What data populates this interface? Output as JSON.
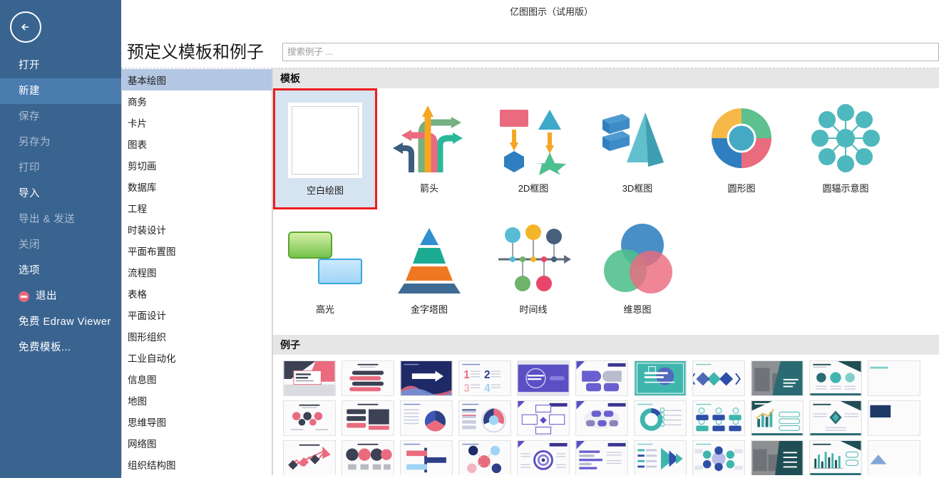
{
  "window": {
    "app_title": "亿图图示（试用版）"
  },
  "sidebar": {
    "back_icon": "back-arrow-icon",
    "items": [
      {
        "label": "打开",
        "state": "normal",
        "icon": null
      },
      {
        "label": "新建",
        "state": "active",
        "icon": null
      },
      {
        "label": "保存",
        "state": "dim",
        "icon": null
      },
      {
        "label": "另存为",
        "state": "dim",
        "icon": null
      },
      {
        "label": "打印",
        "state": "dim",
        "icon": null
      },
      {
        "label": "导入",
        "state": "normal",
        "icon": null
      },
      {
        "label": "导出 & 发送",
        "state": "dim",
        "icon": null
      },
      {
        "label": "关闭",
        "state": "dim",
        "icon": null
      },
      {
        "label": "选项",
        "state": "normal",
        "icon": null
      },
      {
        "label": "退出",
        "state": "normal",
        "icon": "exit-icon"
      },
      {
        "label": "免费 Edraw Viewer",
        "state": "normal",
        "icon": null
      },
      {
        "label": "免费模板...",
        "state": "normal",
        "icon": null
      }
    ]
  },
  "header": {
    "page_title": "预定义模板和例子",
    "search_placeholder": "搜索例子 ...",
    "search_value": ""
  },
  "categories": {
    "selected": "基本绘图",
    "items": [
      "基本绘图",
      "商务",
      "卡片",
      "图表",
      "剪切画",
      "数据库",
      "工程",
      "时装设计",
      "平面布置图",
      "流程图",
      "表格",
      "平面设计",
      "图形组织",
      "工业自动化",
      "信息图",
      "地图",
      "思维导图",
      "网络图",
      "组织结构图"
    ]
  },
  "templates_section": {
    "heading": "模板",
    "selected": "空白绘图",
    "items": [
      {
        "label": "空白绘图",
        "art": "blank-page",
        "selected": true
      },
      {
        "label": "箭头",
        "art": "arrows",
        "selected": false
      },
      {
        "label": "2D框图",
        "art": "block-2d",
        "selected": false
      },
      {
        "label": "3D框图",
        "art": "block-3d",
        "selected": false
      },
      {
        "label": "圆形图",
        "art": "donut",
        "selected": false
      },
      {
        "label": "圆辐示意图",
        "art": "circle-spoke",
        "selected": false
      },
      {
        "label": "高光",
        "art": "highlight",
        "selected": false
      },
      {
        "label": "金字塔图",
        "art": "pyramid",
        "selected": false
      },
      {
        "label": "时间线",
        "art": "timeline",
        "selected": false
      },
      {
        "label": "维恩图",
        "art": "venn",
        "selected": false
      }
    ]
  },
  "examples_section": {
    "heading": "例子",
    "thumb_caption": "Add Your Title Here",
    "groups": [
      {
        "theme": "coral",
        "accent": "#e8697d",
        "dark": "#3d4154"
      },
      {
        "theme": "navy",
        "accent": "#2e3f86",
        "dark": "#1e2a66"
      },
      {
        "theme": "purple",
        "accent": "#5b4fc4",
        "dark": "#3c3490"
      },
      {
        "theme": "teal",
        "accent": "#3fb6ad",
        "dark": "#2e4fa8"
      },
      {
        "theme": "slate",
        "accent": "#2a6b73",
        "dark": "#1f4f55"
      }
    ]
  },
  "colors": {
    "sidebar_bg": "#3a6490",
    "sidebar_active": "#4a7cb0",
    "category_active": "#b3c6e2",
    "selection_border": "#ee1c1c",
    "selection_fill": "#d6e3f0",
    "section_band": "#e6e6e6"
  }
}
